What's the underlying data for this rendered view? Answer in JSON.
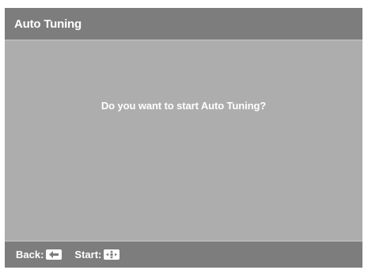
{
  "window": {
    "title": "Auto Tuning"
  },
  "dialog": {
    "prompt": "Do you want to start Auto Tuning?"
  },
  "footer": {
    "back": {
      "label": "Back:",
      "icon": "left-arrow-key-icon"
    },
    "start": {
      "label": "Start:",
      "icon": "center-enter-key-icon"
    }
  },
  "colors": {
    "bar_background": "#7d7d7d",
    "panel_background": "#adadad",
    "text": "#ffffff"
  }
}
